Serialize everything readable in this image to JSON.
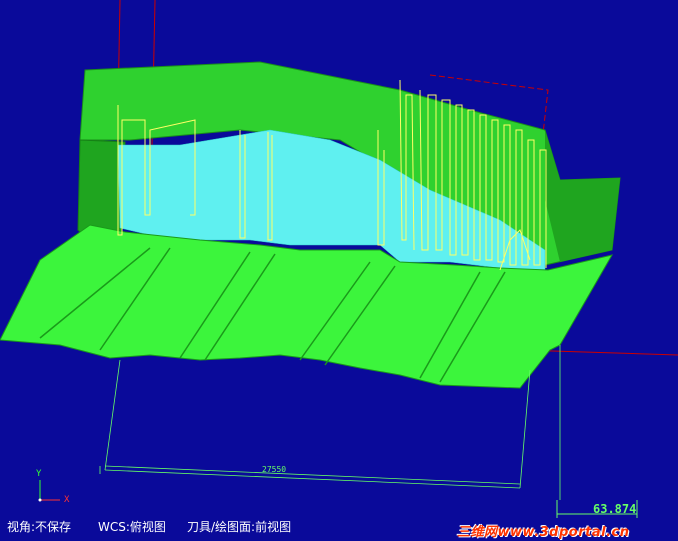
{
  "status_bar": {
    "view_label": "视角:不保存",
    "wcs_label": "WCS:俯视图",
    "tool_label": "刀具/绘图面:前视图"
  },
  "scale": {
    "value": "63.874"
  },
  "dimension": {
    "label": "27550"
  },
  "axes": {
    "x_label": "X",
    "y_label": "Y"
  },
  "watermark": {
    "text": "三维网www.3dportal.cn"
  },
  "colors": {
    "background": "#0a0a9a",
    "surface_bright": "#33ff33",
    "surface_dark": "#22bb22",
    "toolpath_cyan": "#66ffff",
    "toolpath_yellow": "#ffff66",
    "boundary_red": "#cc0000",
    "dimension_green": "#66ff66"
  }
}
